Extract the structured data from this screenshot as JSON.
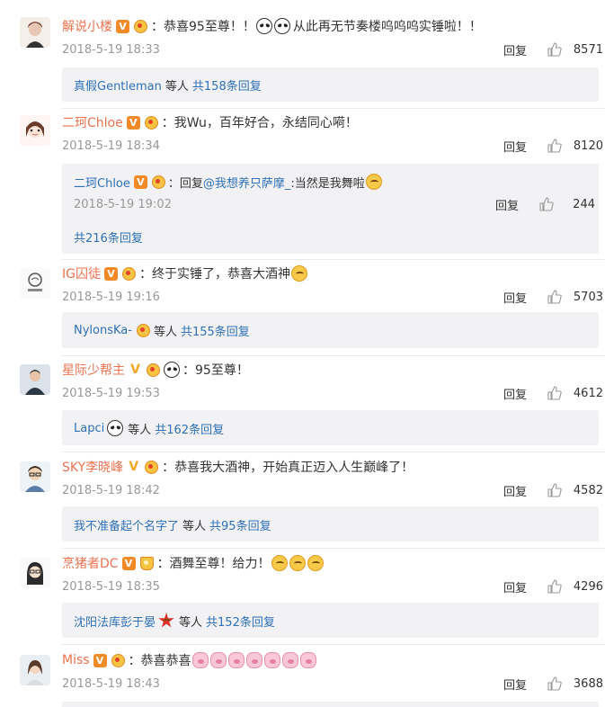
{
  "reply_label": "回复",
  "comments": [
    {
      "username": "解说小楼",
      "badge": "V",
      "text": "：恭喜95至尊！！",
      "text_after_emoji": "从此再无节奏楼呜呜呜实锤啦！！",
      "time": "2018-5-19 18:33",
      "likes": "8571",
      "replies_by": "真假Gentleman",
      "replies_mid": "等人",
      "replies_count": "共158条回复"
    },
    {
      "username": "二珂Chloe",
      "badge": "V",
      "text": "：我Wu，百年好合，永结同心嗬！",
      "time": "2018-5-19 18:34",
      "likes": "8120",
      "sub_reply": {
        "username": "二珂Chloe",
        "badge": "V",
        "prefix": "：回复",
        "mention": "@我想养只萨摩_",
        "text": ":当然是我舞啦",
        "time": "2018-5-19 19:02",
        "likes": "244"
      },
      "replies_count": "共216条回复"
    },
    {
      "username": "IG囚徒",
      "badge": "V",
      "text": "：终于实锤了，恭喜大酒神",
      "time": "2018-5-19 19:16",
      "likes": "5703",
      "replies_by": "NylonsKa-",
      "replies_mid": "等人",
      "replies_count": "共155条回复"
    },
    {
      "username": "星际少帮主",
      "badge": "V",
      "text": "：95至尊！",
      "time": "2018-5-19 19:53",
      "likes": "4612",
      "replies_by": "Lapci",
      "replies_mid": "等人",
      "replies_count": "共162条回复"
    },
    {
      "username": "SKY李晓峰",
      "badge": "V",
      "text": "：恭喜我大酒神，开始真正迈入人生巅峰了！",
      "time": "2018-5-19 18:42",
      "likes": "4582",
      "replies_by": "我不准备起个名字了",
      "replies_mid": "等人",
      "replies_count": "共95条回复"
    },
    {
      "username": "烹猪者DC",
      "badge": "V",
      "text": "：酒舞至尊！给力！",
      "time": "2018-5-19 18:35",
      "likes": "4296",
      "replies_by": "沈阳法库彭于晏",
      "replies_mid": "等人",
      "replies_count": "共152条回复"
    },
    {
      "username": "Miss",
      "badge": "V",
      "text": "：恭喜恭喜",
      "time": "2018-5-19 18:43",
      "likes": "3688"
    }
  ]
}
